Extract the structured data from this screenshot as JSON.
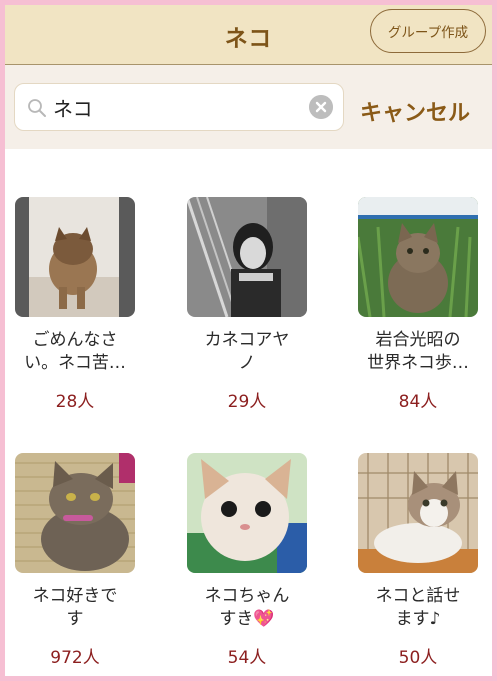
{
  "header": {
    "title": "ネコ",
    "create_group_label": "グループ作成"
  },
  "search": {
    "value": "ネコ",
    "cancel_label": "キャンセル"
  },
  "groups": [
    {
      "name": "ごめんなさ\nい。ネコ苦…",
      "count": "28人"
    },
    {
      "name": "カネコアヤ\nノ",
      "count": "29人"
    },
    {
      "name": "岩合光昭の\n世界ネコ歩…",
      "count": "84人"
    },
    {
      "name": "ネコ好きで\nす",
      "count": "972人"
    },
    {
      "name": "ネコちゃん\nすき💖",
      "count": "54人"
    },
    {
      "name": "ネコと話せ\nます♪",
      "count": "50人"
    }
  ]
}
